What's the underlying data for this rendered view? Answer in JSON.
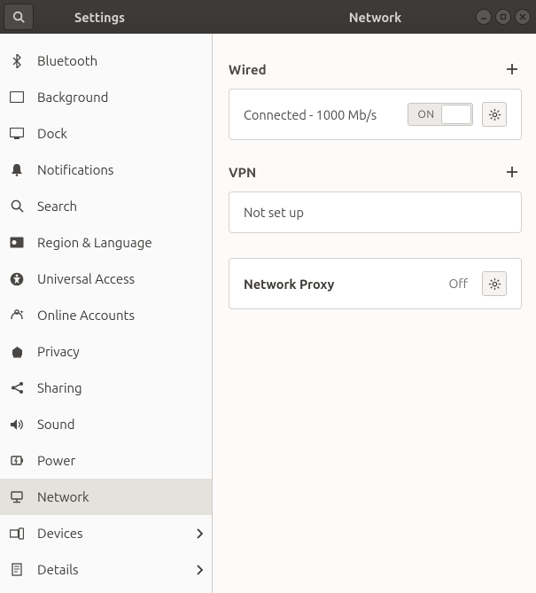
{
  "titlebar": {
    "app_label": "Settings",
    "page_label": "Network"
  },
  "sidebar": {
    "items": [
      {
        "label": "Bluetooth",
        "icon": "bluetooth",
        "chevron": false,
        "selected": false
      },
      {
        "label": "Background",
        "icon": "background",
        "chevron": false,
        "selected": false
      },
      {
        "label": "Dock",
        "icon": "dock",
        "chevron": false,
        "selected": false
      },
      {
        "label": "Notifications",
        "icon": "bell",
        "chevron": false,
        "selected": false
      },
      {
        "label": "Search",
        "icon": "search",
        "chevron": false,
        "selected": false
      },
      {
        "label": "Region & Language",
        "icon": "region",
        "chevron": false,
        "selected": false
      },
      {
        "label": "Universal Access",
        "icon": "accessibility",
        "chevron": false,
        "selected": false
      },
      {
        "label": "Online Accounts",
        "icon": "online-accounts",
        "chevron": false,
        "selected": false
      },
      {
        "label": "Privacy",
        "icon": "privacy",
        "chevron": false,
        "selected": false
      },
      {
        "label": "Sharing",
        "icon": "sharing",
        "chevron": false,
        "selected": false
      },
      {
        "label": "Sound",
        "icon": "sound",
        "chevron": false,
        "selected": false
      },
      {
        "label": "Power",
        "icon": "power",
        "chevron": false,
        "selected": false
      },
      {
        "label": "Network",
        "icon": "network",
        "chevron": false,
        "selected": true
      },
      {
        "label": "Devices",
        "icon": "devices",
        "chevron": true,
        "selected": false
      },
      {
        "label": "Details",
        "icon": "details",
        "chevron": true,
        "selected": false
      }
    ]
  },
  "network": {
    "wired": {
      "title": "Wired",
      "status_text": "Connected - 1000 Mb/s",
      "switch_label": "ON",
      "switch_state": "on"
    },
    "vpn": {
      "title": "VPN",
      "status_text": "Not set up"
    },
    "proxy": {
      "title": "Network Proxy",
      "status_text": "Off"
    }
  }
}
